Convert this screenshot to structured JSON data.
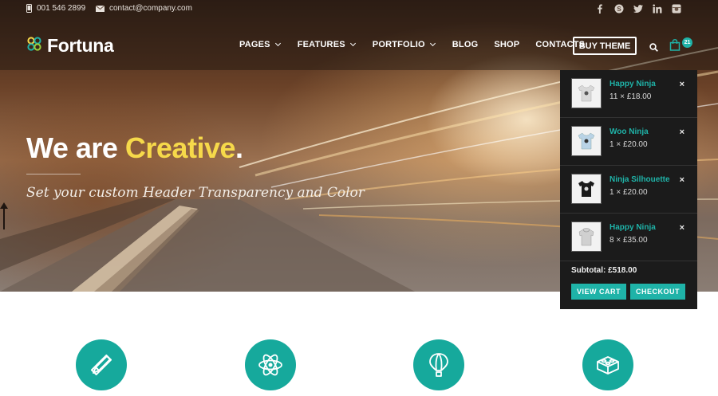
{
  "topbar": {
    "phone": "001 546 2899",
    "email": "contact@company.com",
    "social": [
      "facebook-icon",
      "skype-icon",
      "twitter-icon",
      "linkedin-icon",
      "instagram-icon"
    ]
  },
  "header": {
    "logo_text": "Fortuna",
    "nav": [
      {
        "label": "PAGES",
        "dropdown": true
      },
      {
        "label": "FEATURES",
        "dropdown": true
      },
      {
        "label": "PORTFOLIO",
        "dropdown": true
      },
      {
        "label": "BLOG",
        "dropdown": false
      },
      {
        "label": "SHOP",
        "dropdown": false
      },
      {
        "label": "CONTACTS",
        "dropdown": false
      }
    ],
    "buy_label": "BUY THEME",
    "cart_count": "21"
  },
  "hero": {
    "title_prefix": "We are ",
    "title_accent": "Creative",
    "title_suffix": ".",
    "subtitle": "Set your custom Header Transparency and Color"
  },
  "cart": {
    "items": [
      {
        "name": "Happy Ninja",
        "qty": "11 × £18.00",
        "remove": "×",
        "shirt": "#d9d9d9",
        "type": "tee"
      },
      {
        "name": "Woo Ninja",
        "qty": "1 × £20.00",
        "remove": "×",
        "shirt": "#b9d3e6",
        "type": "tee"
      },
      {
        "name": "Ninja Silhouette",
        "qty": "1 × £20.00",
        "remove": "×",
        "shirt": "#1a1a1a",
        "type": "tee"
      },
      {
        "name": "Happy Ninja",
        "qty": "8 × £35.00",
        "remove": "×",
        "shirt": "#d0d0d0",
        "type": "hoodie"
      }
    ],
    "subtotal": "Subtotal: £518.00",
    "view_cart": "VIEW CART",
    "checkout": "CHECKOUT"
  },
  "features": [
    "pencil-ruler-icon",
    "atom-icon",
    "hot-air-balloon-icon",
    "lego-brick-icon"
  ],
  "colors": {
    "accent": "#1fb3a8",
    "headline_accent": "#f6d94a",
    "feature_circle": "#16a99c",
    "cart_bg": "#1b1b1b"
  }
}
